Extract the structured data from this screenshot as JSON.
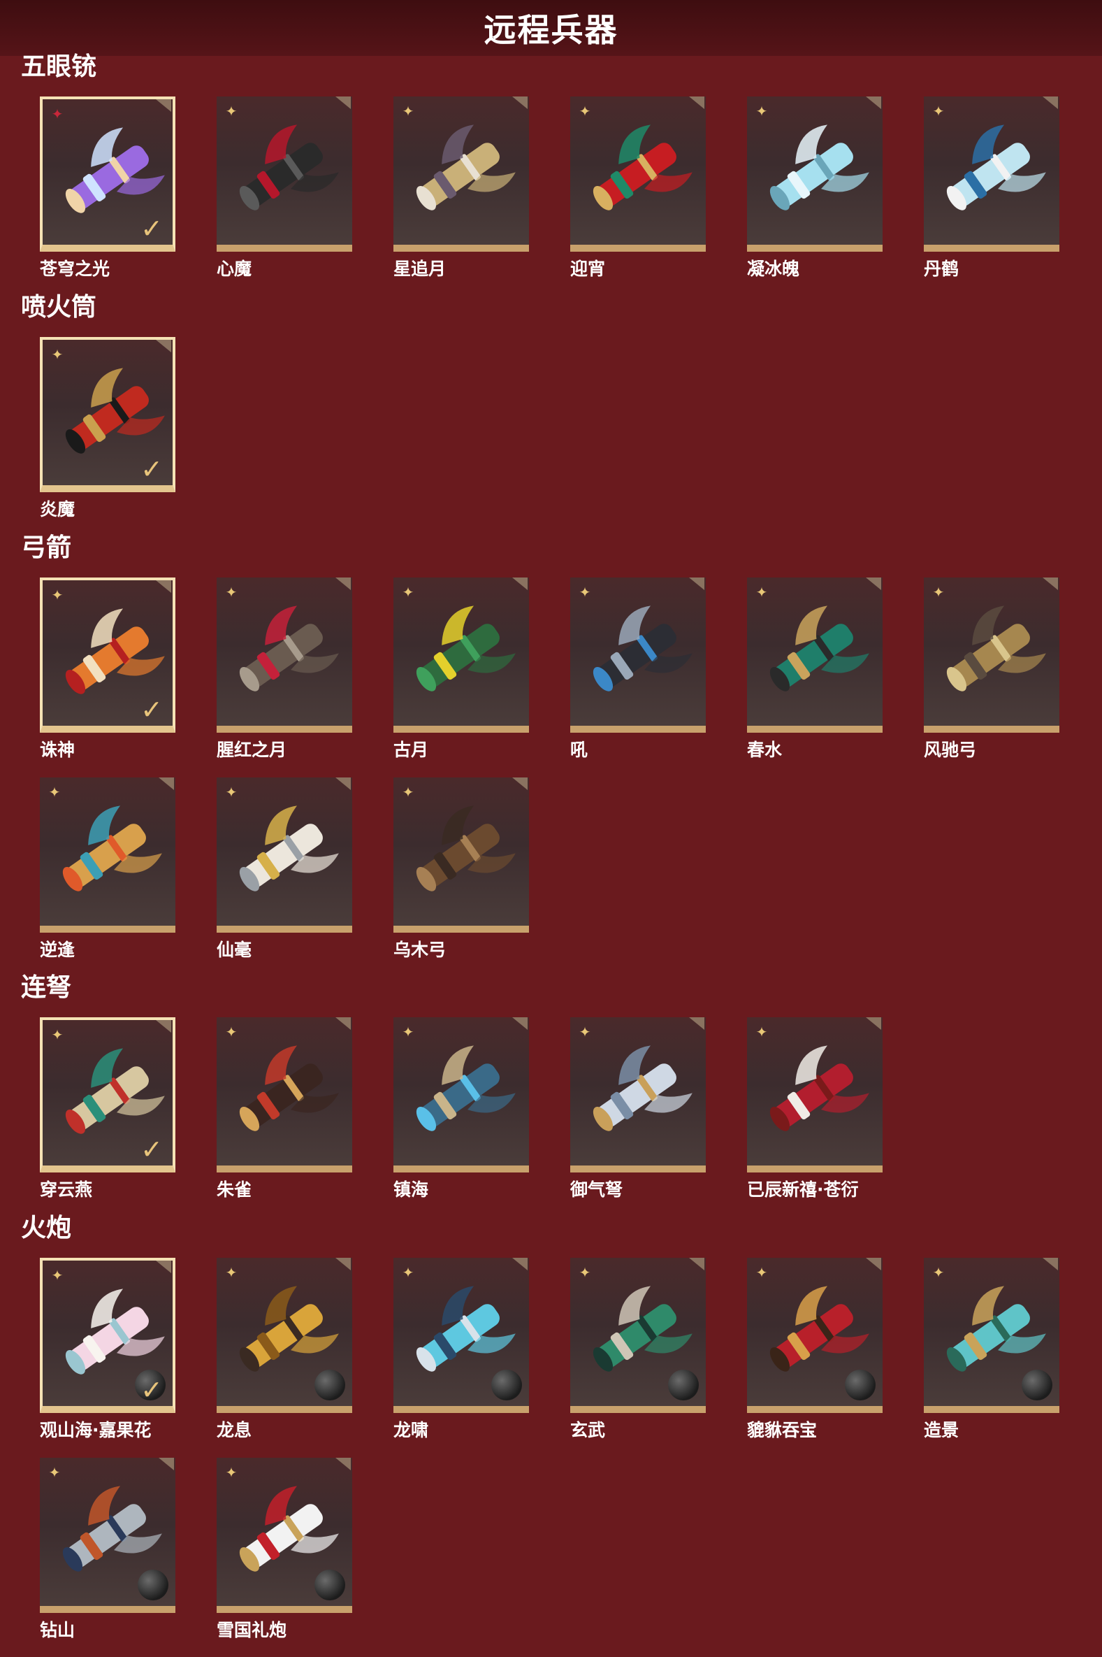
{
  "page_title": "远程兵器",
  "sections": [
    {
      "title": "五眼铳",
      "items": [
        {
          "name": "苍穹之光",
          "selected": true,
          "star": "red",
          "palette": [
            "#9a6ae0",
            "#cfe3ff",
            "#f0d4a8"
          ]
        },
        {
          "name": "心魔",
          "palette": [
            "#2a2a2a",
            "#b5172b",
            "#5a5a5a"
          ]
        },
        {
          "name": "星追月",
          "palette": [
            "#c9b078",
            "#6a5a6e",
            "#e8e0d2"
          ]
        },
        {
          "name": "迎宵",
          "palette": [
            "#c61d22",
            "#1f8a68",
            "#d8b060"
          ]
        },
        {
          "name": "凝冰魄",
          "palette": [
            "#a6e0ef",
            "#e8f6fb",
            "#6aa6b9"
          ]
        },
        {
          "name": "丹鹤",
          "palette": [
            "#bfe4f0",
            "#2b6fa5",
            "#f2f2f2"
          ]
        }
      ]
    },
    {
      "title": "喷火筒",
      "items": [
        {
          "name": "炎魔",
          "selected": true,
          "palette": [
            "#c02a1f",
            "#caa04e",
            "#1a1a1a"
          ]
        }
      ]
    },
    {
      "title": "弓箭",
      "items": [
        {
          "name": "诛神",
          "selected": true,
          "palette": [
            "#e47a2e",
            "#f2e0c0",
            "#b52020"
          ]
        },
        {
          "name": "腥红之月",
          "palette": [
            "#6a5b50",
            "#c4213a",
            "#a79b8c"
          ]
        },
        {
          "name": "古月",
          "palette": [
            "#2e6b3e",
            "#e4d02c",
            "#3fa05c"
          ]
        },
        {
          "name": "吼",
          "palette": [
            "#2c2d34",
            "#9aa8b8",
            "#3b88c7"
          ]
        },
        {
          "name": "春水",
          "palette": [
            "#1f7e6a",
            "#c9a35c",
            "#2a2a2a"
          ]
        },
        {
          "name": "风驰弓",
          "palette": [
            "#a6874f",
            "#5a4b3f",
            "#d9c58c"
          ]
        },
        {
          "name": "逆逢",
          "palette": [
            "#d8a04c",
            "#3c9fb5",
            "#e05a2a"
          ]
        },
        {
          "name": "仙毫",
          "palette": [
            "#ece6dc",
            "#d6b04a",
            "#9aa0a6"
          ]
        },
        {
          "name": "乌木弓",
          "palette": [
            "#6b4a2f",
            "#3a2a22",
            "#a78054"
          ]
        }
      ]
    },
    {
      "title": "连弩",
      "items": [
        {
          "name": "穿云燕",
          "selected": true,
          "palette": [
            "#d7c7a0",
            "#2a8f7a",
            "#c0302a"
          ]
        },
        {
          "name": "朱雀",
          "palette": [
            "#3a2520",
            "#c23a2a",
            "#d6a55a"
          ]
        },
        {
          "name": "镇海",
          "palette": [
            "#3a6a88",
            "#c9b48a",
            "#5ac0e8"
          ]
        },
        {
          "name": "御气弩",
          "palette": [
            "#cfd8e4",
            "#7a8ea6",
            "#c9a05a"
          ]
        },
        {
          "name": "已辰新禧·苍衍",
          "palette": [
            "#b21e2e",
            "#f0ece6",
            "#7a1a1a"
          ]
        }
      ]
    },
    {
      "title": "火炮",
      "items": [
        {
          "name": "观山海·嘉果花",
          "selected": true,
          "palette": [
            "#f4d6e4",
            "#f8f4ef",
            "#9ac6d0"
          ]
        },
        {
          "name": "龙息",
          "palette": [
            "#d9a43a",
            "#8a5a1a",
            "#3a2a22"
          ]
        },
        {
          "name": "龙啸",
          "palette": [
            "#5ec8e0",
            "#2a4a6a",
            "#d8e2ea"
          ]
        },
        {
          "name": "玄武",
          "palette": [
            "#2f8a6a",
            "#cfc6b6",
            "#1a3a32"
          ]
        },
        {
          "name": "貔貅吞宝",
          "palette": [
            "#b8202a",
            "#d8a04a",
            "#3a2418"
          ]
        },
        {
          "name": "造景",
          "palette": [
            "#5fc4c8",
            "#c9a35a",
            "#2a6a5a"
          ]
        },
        {
          "name": "钻山",
          "palette": [
            "#aeb6be",
            "#c0562a",
            "#2a3a5a"
          ]
        },
        {
          "name": "雪国礼炮",
          "palette": [
            "#f2f2f2",
            "#c2202a",
            "#c9a35a"
          ]
        }
      ]
    }
  ]
}
